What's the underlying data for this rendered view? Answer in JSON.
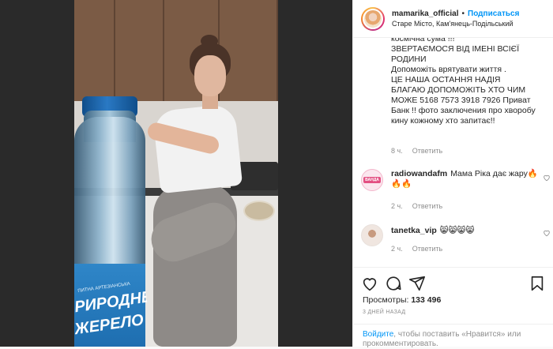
{
  "header": {
    "username": "mamarika_official",
    "separator": "•",
    "follow_label": "Подписаться",
    "location": "Старе Місто, Кам'янець-Подільський"
  },
  "media": {
    "bottle_label_small": "ПИТНА АРТЕЗІАНСЬКА",
    "bottle_label_line1": "РИРОДНЕ",
    "bottle_label_line2": "ЖЕРЕЛО"
  },
  "caption": {
    "text": "космічна сума !!!\nЗВЕРТАЄМОСЯ ВІД ІМЕНІ ВСІЄЇ РОДИНИ\nДопоможіть врятувати життя .\nЦЕ НАША ОСТАННЯ НАДІЯ\nБЛАГАЮ ДОПОМОЖІТЬ ХТО ЧИМ МОЖЕ 5168 7573 3918 7926 Приват Банк !! фото заключения про хворобу кину кожному хто запитає!!",
    "time": "8 ч.",
    "reply_label": "Ответить"
  },
  "comments": [
    {
      "username": "radiowandafm",
      "avatar_text": "ВАНДА",
      "text": "Мама Ріка дає жару🔥🔥🔥",
      "time": "2 ч.",
      "reply_label": "Ответить"
    },
    {
      "username": "tanetka_vip",
      "text": "😸😸😸😸",
      "time": "2 ч.",
      "reply_label": "Ответить"
    }
  ],
  "actions": {
    "icons": [
      "heart-icon",
      "comment-icon",
      "share-icon",
      "bookmark-icon"
    ]
  },
  "views": {
    "label": "Просмотры:",
    "count": "133 496"
  },
  "posted": "3 ДНЕЙ НАЗАД",
  "login": {
    "link_label": "Войдите",
    "text": ", чтобы поставить «Нравится» или прокомментировать."
  },
  "colors": {
    "accent": "#0095f6",
    "muted": "#8e8e8e",
    "text": "#262626"
  }
}
